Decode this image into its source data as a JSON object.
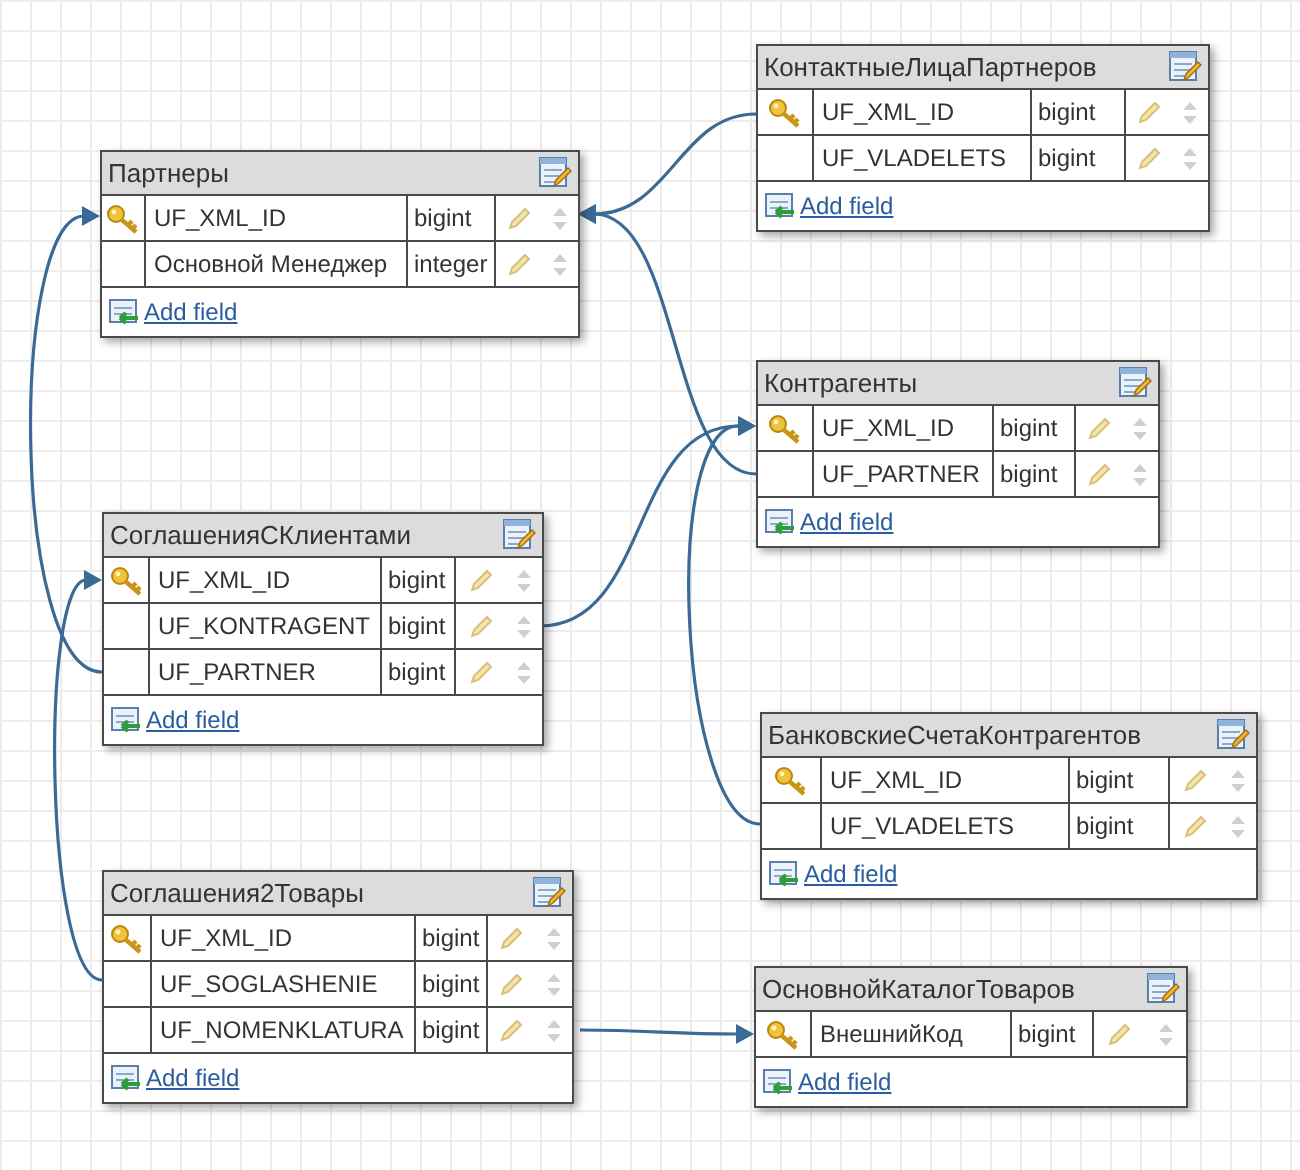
{
  "tables": [
    {
      "name": "Партнеры",
      "fields": [
        {
          "name": "UF_XML_ID",
          "type": "bigint",
          "primary_key": true
        },
        {
          "name": "Основной Менеджер",
          "type": "integer",
          "primary_key": false
        }
      ],
      "add_field": "Add field"
    },
    {
      "name": "КонтактныеЛицаПартнеров",
      "fields": [
        {
          "name": "UF_XML_ID",
          "type": "bigint",
          "primary_key": true
        },
        {
          "name": "UF_VLADELETS",
          "type": "bigint",
          "primary_key": false
        }
      ],
      "add_field": "Add field"
    },
    {
      "name": "Контрагенты",
      "fields": [
        {
          "name": "UF_XML_ID",
          "type": "bigint",
          "primary_key": true
        },
        {
          "name": "UF_PARTNER",
          "type": "bigint",
          "primary_key": false
        }
      ],
      "add_field": "Add field"
    },
    {
      "name": "СоглашенияСКлиентами",
      "fields": [
        {
          "name": "UF_XML_ID",
          "type": "bigint",
          "primary_key": true
        },
        {
          "name": "UF_KONTRAGENT",
          "type": "bigint",
          "primary_key": false
        },
        {
          "name": "UF_PARTNER",
          "type": "bigint",
          "primary_key": false
        }
      ],
      "add_field": "Add field"
    },
    {
      "name": "БанковскиеСчетаКонтрагентов",
      "fields": [
        {
          "name": "UF_XML_ID",
          "type": "bigint",
          "primary_key": true
        },
        {
          "name": "UF_VLADELETS",
          "type": "bigint",
          "primary_key": false
        }
      ],
      "add_field": "Add field"
    },
    {
      "name": "Соглашения2Товары",
      "fields": [
        {
          "name": "UF_XML_ID",
          "type": "bigint",
          "primary_key": true
        },
        {
          "name": "UF_SOGLASHENIE",
          "type": "bigint",
          "primary_key": false
        },
        {
          "name": "UF_NOMENKLATURA",
          "type": "bigint",
          "primary_key": false
        }
      ],
      "add_field": "Add field"
    },
    {
      "name": "ОсновнойКаталогТоваров",
      "fields": [
        {
          "name": "ВнешнийКод",
          "type": "bigint",
          "primary_key": true
        }
      ],
      "add_field": "Add field"
    }
  ]
}
